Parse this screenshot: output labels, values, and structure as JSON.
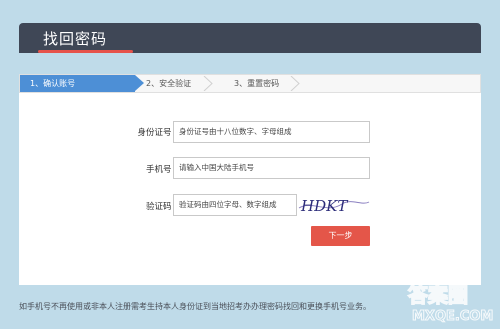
{
  "header": {
    "title": "找回密码"
  },
  "steps": [
    {
      "label": "1、确认账号",
      "active": true
    },
    {
      "label": "2、安全验证",
      "active": false
    },
    {
      "label": "3、重置密码",
      "active": false
    }
  ],
  "form": {
    "id_label": "身份证号：",
    "id_placeholder": "身份证号由十八位数字、字母组成",
    "phone_label": "手机号：",
    "phone_placeholder": "请输入中国大陆手机号",
    "captcha_label": "验证码：",
    "captcha_placeholder": "验证码由四位字母、数字组成",
    "captcha_text": "HDKT",
    "next_label": "下一步"
  },
  "footer": {
    "note": "如手机号不再使用或非本人注册需考生持本人身份证到当地招考办办理密码找回和更换手机号业务。"
  },
  "watermark": {
    "line1": "答案圈",
    "line2": "MXQE.COM"
  },
  "colors": {
    "background": "#bfdbe9",
    "header": "#3f4756",
    "accent_red": "#e45649",
    "step_active": "#4d8fd6"
  }
}
